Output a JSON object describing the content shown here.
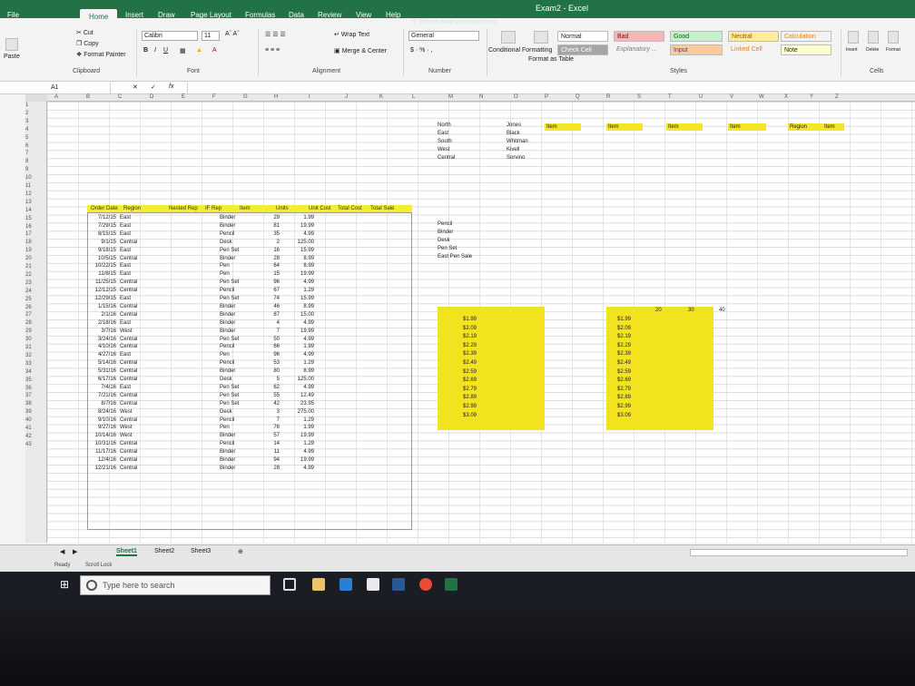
{
  "window": {
    "title": "Exam2 - Excel"
  },
  "tabs": [
    "File",
    "Home",
    "Insert",
    "Draw",
    "Page Layout",
    "Formulas",
    "Data",
    "Review",
    "View",
    "Help"
  ],
  "tell_me": "Tell me what you want to do",
  "ribbon": {
    "clipboard": {
      "cut": "Cut",
      "copy": "Copy",
      "painter": "Format Painter",
      "paste": "Paste",
      "label": "Clipboard"
    },
    "font": {
      "name": "Calibri",
      "size": "11",
      "label": "Font"
    },
    "alignment": {
      "wrap": "Wrap Text",
      "merge": "Merge & Center",
      "label": "Alignment"
    },
    "number": {
      "format": "General",
      "label": "Number"
    },
    "styles": {
      "conditional": "Conditional Formatting",
      "format_table": "Format as Table",
      "label": "Styles",
      "normal": "Normal",
      "bad": "Bad",
      "good": "Good",
      "neutral": "Neutral",
      "calculation": "Calculation",
      "check_cell": "Check Cell",
      "explanatory": "Explanatory ...",
      "input": "Input",
      "linked_cell": "Linked Cell",
      "note": "Note"
    },
    "cells": {
      "insert": "Insert",
      "delete": "Delete",
      "format": "Format",
      "label": "Cells"
    }
  },
  "formula_bar": {
    "name_box": "A1",
    "fx": "fx"
  },
  "columns": [
    "A",
    "B",
    "C",
    "D",
    "E",
    "F",
    "G",
    "H",
    "I",
    "J",
    "K",
    "L",
    "M",
    "N",
    "O",
    "P",
    "Q",
    "R",
    "S",
    "T",
    "U",
    "V",
    "W",
    "X",
    "Y",
    "Z"
  ],
  "rows": [
    "1",
    "2",
    "3",
    "4",
    "5",
    "6",
    "7",
    "8",
    "9",
    "10",
    "11",
    "12",
    "13",
    "14",
    "15",
    "16",
    "17",
    "18",
    "19",
    "20",
    "21",
    "22",
    "23",
    "24",
    "25",
    "26",
    "27",
    "28",
    "29",
    "30",
    "31",
    "32",
    "33",
    "34",
    "35",
    "36",
    "37",
    "38",
    "39",
    "40",
    "41",
    "42",
    "43"
  ],
  "table_headers": [
    "Order Date",
    "Region",
    "Nested Rep",
    "IF Rep",
    "Item",
    "Units",
    "Unit Cost",
    "Total Cost",
    "Total Sale"
  ],
  "table_rows": [
    [
      "7/12/15",
      "East",
      "Binder",
      "29",
      "1.99"
    ],
    [
      "7/29/15",
      "East",
      "Binder",
      "81",
      "19.99"
    ],
    [
      "8/15/15",
      "East",
      "Pencil",
      "35",
      "4.99"
    ],
    [
      "9/1/15",
      "Central",
      "Desk",
      "2",
      "125.00"
    ],
    [
      "9/18/15",
      "East",
      "Pen Set",
      "16",
      "15.99"
    ],
    [
      "10/5/15",
      "Central",
      "Binder",
      "28",
      "8.99"
    ],
    [
      "10/22/15",
      "East",
      "Pen",
      "64",
      "8.99"
    ],
    [
      "11/8/15",
      "East",
      "Pen",
      "15",
      "19.99"
    ],
    [
      "11/25/15",
      "Central",
      "Pen Set",
      "96",
      "4.99"
    ],
    [
      "12/12/15",
      "Central",
      "Pencil",
      "67",
      "1.29"
    ],
    [
      "12/29/15",
      "East",
      "Pen Set",
      "74",
      "15.99"
    ],
    [
      "1/15/16",
      "Central",
      "Binder",
      "46",
      "8.99"
    ],
    [
      "2/1/16",
      "Central",
      "Binder",
      "87",
      "15.00"
    ],
    [
      "2/18/16",
      "East",
      "Binder",
      "4",
      "4.99"
    ],
    [
      "3/7/16",
      "West",
      "Binder",
      "7",
      "19.99"
    ],
    [
      "3/24/16",
      "Central",
      "Pen Set",
      "50",
      "4.99"
    ],
    [
      "4/10/16",
      "Central",
      "Pencil",
      "66",
      "1.99"
    ],
    [
      "4/27/16",
      "East",
      "Pen",
      "96",
      "4.99"
    ],
    [
      "5/14/16",
      "Central",
      "Pencil",
      "53",
      "1.29"
    ],
    [
      "5/31/16",
      "Central",
      "Binder",
      "80",
      "8.99"
    ],
    [
      "6/17/16",
      "Central",
      "Desk",
      "5",
      "125.00"
    ],
    [
      "7/4/16",
      "East",
      "Pen Set",
      "62",
      "4.99"
    ],
    [
      "7/21/16",
      "Central",
      "Pen Set",
      "55",
      "12.49"
    ],
    [
      "8/7/16",
      "Central",
      "Pen Set",
      "42",
      "23.95"
    ],
    [
      "8/24/16",
      "West",
      "Desk",
      "3",
      "275.00"
    ],
    [
      "9/10/16",
      "Central",
      "Pencil",
      "7",
      "1.29"
    ],
    [
      "9/27/16",
      "West",
      "Pen",
      "76",
      "1.99"
    ],
    [
      "10/14/16",
      "West",
      "Binder",
      "57",
      "19.99"
    ],
    [
      "10/31/16",
      "Central",
      "Pencil",
      "14",
      "1.29"
    ],
    [
      "11/17/16",
      "Central",
      "Binder",
      "11",
      "4.99"
    ],
    [
      "12/4/16",
      "Central",
      "Binder",
      "94",
      "19.99"
    ],
    [
      "12/21/16",
      "Central",
      "Binder",
      "28",
      "4.99"
    ]
  ],
  "lookup_regions": [
    "North",
    "East",
    "South",
    "West",
    "Central"
  ],
  "lookup_reps": [
    "Jones",
    "Black",
    "Whitman",
    "Kivell",
    "Sorvino"
  ],
  "item_labels": [
    "Pencil",
    "Binder",
    "Desk",
    "Pen Set",
    "East Pen Sale"
  ],
  "item_headers": {
    "o": "Item",
    "q": "Item",
    "s": "Item",
    "u": "Item",
    "w": "Region",
    "x": "Item"
  },
  "price_list": [
    "$1.99",
    "$2.09",
    "$2.19",
    "$2.29",
    "$2.39",
    "$2.49",
    "$2.59",
    "$2.69",
    "$2.79",
    "$2.89",
    "$2.99",
    "$3.09"
  ],
  "number_headers": [
    "20",
    "30",
    "40"
  ],
  "sheets": [
    "Sheet1",
    "Sheet2",
    "Sheet3"
  ],
  "status": {
    "ready": "Ready",
    "scroll_lock": "Scroll Lock"
  },
  "taskbar": {
    "search_placeholder": "Type here to search"
  }
}
